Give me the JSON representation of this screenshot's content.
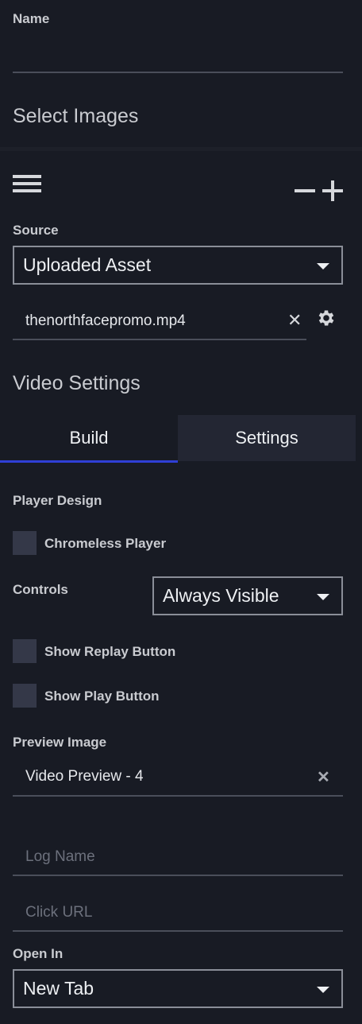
{
  "name_field": {
    "label": "Name",
    "value": ""
  },
  "select_images": {
    "title": "Select Images"
  },
  "toolbar": {
    "menu_icon": "hamburger-icon",
    "minus_icon": "minus-icon",
    "plus_icon": "plus-icon"
  },
  "source": {
    "label": "Source",
    "selected": "Uploaded Asset"
  },
  "asset": {
    "filename": "thenorthfacepromo.mp4",
    "clear_icon": "close-icon",
    "settings_icon": "gear-icon"
  },
  "video_settings": {
    "title": "Video Settings"
  },
  "tabs": [
    {
      "label": "Build",
      "active": true
    },
    {
      "label": "Settings",
      "active": false
    }
  ],
  "player_design": {
    "label": "Player Design"
  },
  "chromeless": {
    "label": "Chromeless Player",
    "checked": false
  },
  "controls": {
    "label": "Controls",
    "selected": "Always Visible"
  },
  "replay": {
    "label": "Show Replay Button",
    "checked": false
  },
  "play": {
    "label": "Show Play Button",
    "checked": false
  },
  "preview_image": {
    "label": "Preview Image",
    "value": "Video Preview - 4",
    "clear_icon": "close-icon"
  },
  "log_name": {
    "placeholder": "Log Name"
  },
  "click_url": {
    "placeholder": "Click URL"
  },
  "open_in": {
    "label": "Open In",
    "selected": "New Tab"
  },
  "colors": {
    "background": "#181b24",
    "tab_inactive": "#232633",
    "tab_underline": "#2f3fd6",
    "checkbox": "#343848"
  }
}
